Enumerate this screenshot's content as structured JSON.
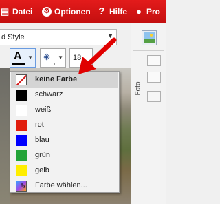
{
  "menubar": {
    "datei_label": "Datei",
    "optionen_label": "Optionen",
    "hilfe_label": "Hilfe",
    "props_label": "Pro",
    "bg_color": "#d41414"
  },
  "toolbar": {
    "style_value": "d Style",
    "font_size_value": "18",
    "font_color_icon": "text-color-icon",
    "fill_icon": "fill-bucket-icon"
  },
  "right_panel": {
    "foto_label": "Foto"
  },
  "color_menu": {
    "items": [
      {
        "label": "keine Farbe",
        "color": "none",
        "selected": true
      },
      {
        "label": "schwarz",
        "color": "#000000"
      },
      {
        "label": "weiß",
        "color": "#ffffff"
      },
      {
        "label": "rot",
        "color": "#e11d0d"
      },
      {
        "label": "blau",
        "color": "#0000ff"
      },
      {
        "label": "grün",
        "color": "#23a338"
      },
      {
        "label": "gelb",
        "color": "#ffee00"
      },
      {
        "label": "Farbe wählen...",
        "color": "picker"
      }
    ]
  },
  "annotation": {
    "arrow_color": "#e00000"
  }
}
